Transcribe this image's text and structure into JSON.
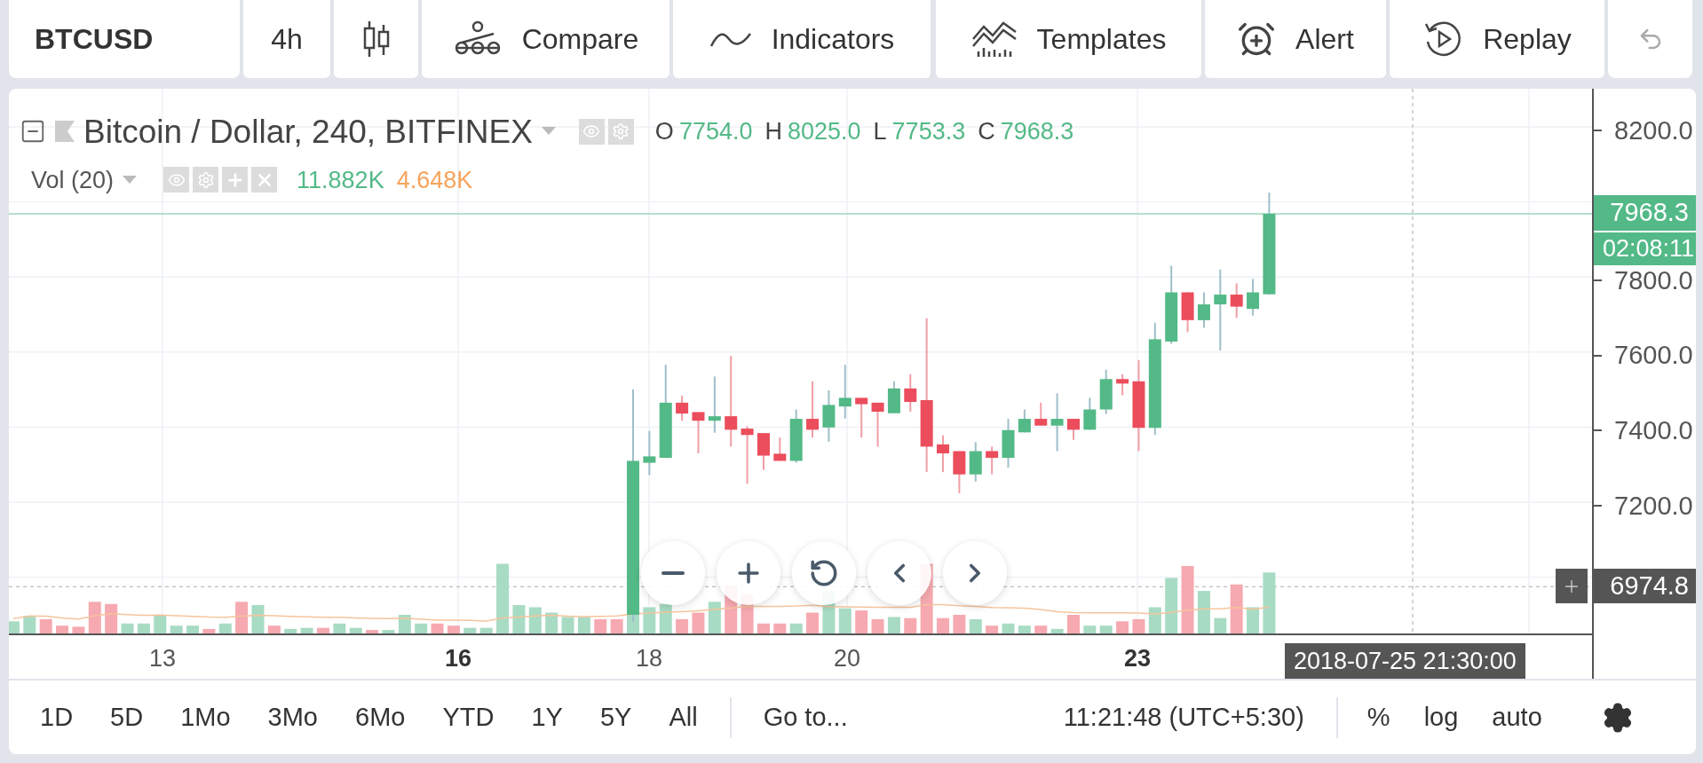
{
  "toolbar": {
    "symbol": "BTCUSD",
    "interval": "4h",
    "buttons": [
      {
        "kind": "compare",
        "label": "Compare"
      },
      {
        "kind": "indicators",
        "label": "Indicators"
      },
      {
        "kind": "templates",
        "label": "Templates"
      },
      {
        "kind": "alert",
        "label": "Alert"
      },
      {
        "kind": "replay",
        "label": "Replay"
      }
    ]
  },
  "legend": {
    "title": "Bitcoin / Dollar, 240, BITFINEX",
    "ohlc": [
      {
        "key": "O",
        "value": "7754.0"
      },
      {
        "key": "H",
        "value": "8025.0"
      },
      {
        "key": "L",
        "value": "7753.3"
      },
      {
        "key": "C",
        "value": "7968.3"
      }
    ]
  },
  "volume_legend": {
    "title": "Vol (20)",
    "values": [
      {
        "text": "11.882K",
        "color": "#53b987"
      },
      {
        "text": "4.648K",
        "color": "#f7a35c"
      }
    ]
  },
  "price_axis": {
    "ticks": [
      "8200.0",
      "7800.0",
      "7600.0",
      "7400.0",
      "7200.0"
    ],
    "last_price": "7968.3",
    "countdown": "02:08:11",
    "crosshair_price": "6974.8"
  },
  "time_axis": {
    "ticks": [
      {
        "label": "13",
        "bold": false
      },
      {
        "label": "16",
        "bold": true
      },
      {
        "label": "18",
        "bold": false
      },
      {
        "label": "20",
        "bold": false
      },
      {
        "label": "23",
        "bold": true
      }
    ],
    "crosshair_time": "2018-07-25 21:30:00"
  },
  "range_bar": {
    "ranges": [
      "1D",
      "5D",
      "1Mo",
      "3Mo",
      "6Mo",
      "YTD",
      "1Y",
      "5Y",
      "All"
    ],
    "goto": "Go to...",
    "clock": "11:21:48 (UTC+5:30)",
    "options": [
      "%",
      "log",
      "auto"
    ]
  }
}
